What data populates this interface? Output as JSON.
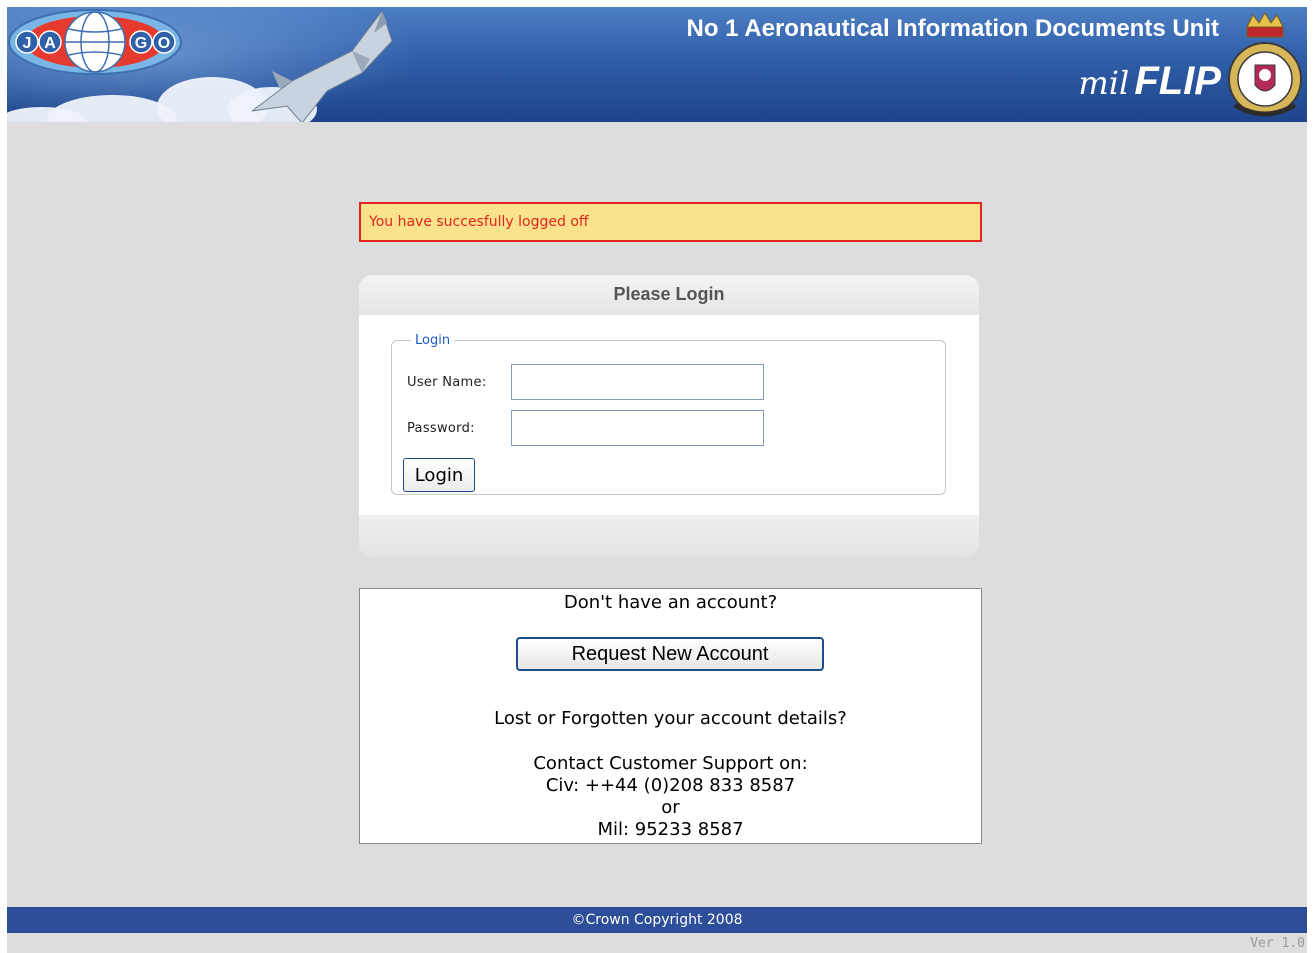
{
  "header": {
    "logo": {
      "letters": [
        "J",
        "A",
        "G",
        "O"
      ]
    },
    "unit_title": "No 1 Aeronautical Information Documents Unit",
    "brand_prefix": "mil",
    "brand_name": "FLIP"
  },
  "alert": {
    "message": "You have succesfully logged off"
  },
  "login": {
    "panel_title": "Please Login",
    "fieldset_legend": "Login",
    "username_label": "User Name:",
    "username_value": "",
    "password_label": "Password:",
    "password_value": "",
    "submit_label": "Login"
  },
  "account": {
    "no_account_text": "Don't have an account?",
    "request_button": "Request New Account",
    "lost_details_text": "Lost or Forgotten your account details?",
    "contact_heading": "Contact Customer Support on:",
    "civ_phone": "Civ: ++44 (0)208 833 8587",
    "or_text": "or",
    "mil_phone": "Mil: 95233 8587"
  },
  "footer": {
    "copyright": "©Crown Copyright 2008",
    "version": "Ver 1.0"
  },
  "colors": {
    "banner": "#2f5ea8",
    "footer": "#2d4f9a",
    "alert_bg": "#fae38c",
    "alert_text": "#e0261e",
    "legend_blue": "#1f59c4",
    "page_bg": "#dddddd"
  }
}
